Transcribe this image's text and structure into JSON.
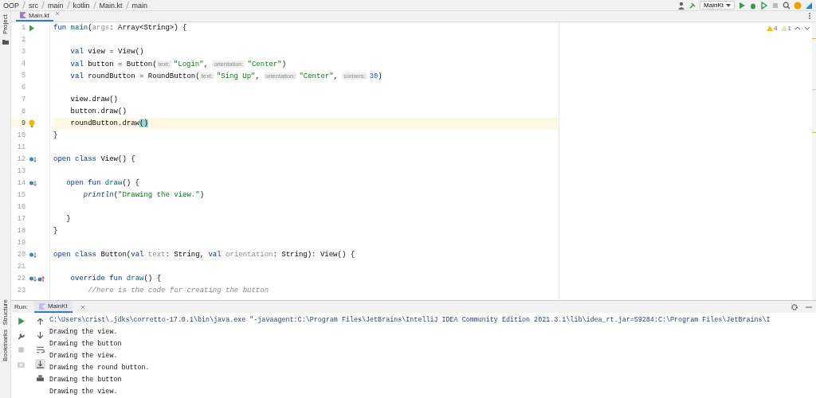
{
  "breadcrumbs": [
    "OOP",
    "src",
    "main",
    "kotlin",
    "Main.kt",
    "main"
  ],
  "toolbar": {
    "run_config": "MainKt"
  },
  "left_strip": [
    "Project"
  ],
  "editor": {
    "tabs": [
      {
        "label": "Main.kt",
        "selected": true
      }
    ],
    "inspections": {
      "warnings": "4",
      "weak_warnings": "1"
    },
    "lines": [
      {
        "number": "1",
        "gutter": {
          "kind": "run"
        },
        "current": false,
        "tokens": [
          {
            "kind": "keyword",
            "text": "fun "
          },
          {
            "kind": "declaration",
            "text": "main"
          },
          {
            "kind": "plain",
            "text": "("
          },
          {
            "kind": "param",
            "text": "args"
          },
          {
            "kind": "plain",
            "text": ": Array<String>) {"
          }
        ]
      },
      {
        "number": "2",
        "current": false
      },
      {
        "number": "3",
        "current": false,
        "tokens": [
          {
            "kind": "keyword",
            "text": "    val "
          },
          {
            "kind": "plain",
            "text": "view = View()"
          }
        ]
      },
      {
        "number": "4",
        "current": false,
        "tokens": [
          {
            "kind": "keyword",
            "text": "    val "
          },
          {
            "kind": "plain",
            "text": "button = Button("
          },
          {
            "kind": "hint",
            "text": "text:"
          },
          {
            "kind": "string",
            "text": "\"Login\""
          },
          {
            "kind": "plain",
            "text": ", "
          },
          {
            "kind": "hint",
            "text": "orientation:"
          },
          {
            "kind": "string",
            "text": "\"Center\""
          },
          {
            "kind": "plain",
            "text": ")"
          }
        ]
      },
      {
        "number": "5",
        "current": false,
        "tokens": [
          {
            "kind": "keyword",
            "text": "    val "
          },
          {
            "kind": "plain",
            "text": "roundButton = RoundButton("
          },
          {
            "kind": "hint",
            "text": "text:"
          },
          {
            "kind": "string",
            "text": "\"Sing Up\""
          },
          {
            "kind": "plain",
            "text": ", "
          },
          {
            "kind": "hint",
            "text": "orientation:"
          },
          {
            "kind": "string",
            "text": "\"Center\""
          },
          {
            "kind": "plain",
            "text": ", "
          },
          {
            "kind": "hint",
            "text": "corners:"
          },
          {
            "kind": "number",
            "text": "30"
          },
          {
            "kind": "plain",
            "text": ")"
          }
        ]
      },
      {
        "number": "6",
        "current": false
      },
      {
        "number": "7",
        "current": false,
        "tokens": [
          {
            "kind": "plain",
            "text": "    view.draw()"
          }
        ]
      },
      {
        "number": "8",
        "current": false,
        "tokens": [
          {
            "kind": "plain",
            "text": "    button.draw()"
          }
        ]
      },
      {
        "number": "9",
        "gutter": {
          "kind": "bulb"
        },
        "current": true,
        "tokens": [
          {
            "kind": "plain",
            "text": "    roundButton.draw"
          },
          {
            "kind": "match",
            "text": "()"
          }
        ]
      },
      {
        "number": "10",
        "current": false,
        "tokens": [
          {
            "kind": "plain",
            "text": "}"
          }
        ]
      },
      {
        "number": "11",
        "current": false
      },
      {
        "number": "12",
        "gutter": {
          "kind": "override"
        },
        "current": false,
        "tokens": [
          {
            "kind": "keyword",
            "text": "open class "
          },
          {
            "kind": "plain",
            "text": "View() {"
          }
        ]
      },
      {
        "number": "13",
        "current": false
      },
      {
        "number": "14",
        "gutter": {
          "kind": "override"
        },
        "current": false,
        "tokens": [
          {
            "kind": "keyword",
            "text": "   open fun "
          },
          {
            "kind": "declaration",
            "text": "draw"
          },
          {
            "kind": "plain",
            "text": "() {"
          }
        ]
      },
      {
        "number": "15",
        "current": false,
        "tokens": [
          {
            "kind": "call",
            "text": "       println"
          },
          {
            "kind": "plain",
            "text": "("
          },
          {
            "kind": "string",
            "text": "\"Drawing the view.\""
          },
          {
            "kind": "plain",
            "text": ")"
          }
        ]
      },
      {
        "number": "16",
        "current": false
      },
      {
        "number": "17",
        "current": false,
        "tokens": [
          {
            "kind": "plain",
            "text": "   }"
          }
        ]
      },
      {
        "number": "18",
        "current": false,
        "tokens": [
          {
            "kind": "plain",
            "text": "}"
          }
        ]
      },
      {
        "number": "19",
        "current": false
      },
      {
        "number": "20",
        "gutter": {
          "kind": "override"
        },
        "current": false,
        "tokens": [
          {
            "kind": "keyword",
            "text": "open class "
          },
          {
            "kind": "plain",
            "text": "Button("
          },
          {
            "kind": "keyword",
            "text": "val "
          },
          {
            "kind": "param",
            "text": "text"
          },
          {
            "kind": "plain",
            "text": ": String, "
          },
          {
            "kind": "keyword",
            "text": "val "
          },
          {
            "kind": "param",
            "text": "orientation"
          },
          {
            "kind": "plain",
            "text": ": String): View() {"
          }
        ]
      },
      {
        "number": "21",
        "current": false
      },
      {
        "number": "22",
        "gutter": {
          "kind": "both"
        },
        "current": false,
        "tokens": [
          {
            "kind": "keyword",
            "text": "    override fun "
          },
          {
            "kind": "declaration",
            "text": "draw"
          },
          {
            "kind": "plain",
            "text": "() {"
          }
        ]
      },
      {
        "number": "23",
        "current": false,
        "tokens": [
          {
            "kind": "comment",
            "text": "        //here is the code for creating the button"
          }
        ]
      }
    ]
  },
  "bottom_strip": [
    "Structure",
    "Bookmarks"
  ],
  "run_panel": {
    "label": "Run:",
    "tabs": [
      {
        "label": "MainKt",
        "selected": true
      }
    ],
    "output": [
      "C:\\Users\\crist\\.jdks\\corretto-17.0.1\\bin\\java.exe \"-javaagent:C:\\Program Files\\JetBrains\\IntelliJ IDEA Community Edition 2021.3.1\\lib\\idea_rt.jar=59284:C:\\Program Files\\JetBrains\\I",
      "Drawing the view.",
      "Drawing the button",
      "Drawing the view.",
      "Drawing the round button.",
      "Drawing the button",
      "Drawing the view."
    ]
  }
}
